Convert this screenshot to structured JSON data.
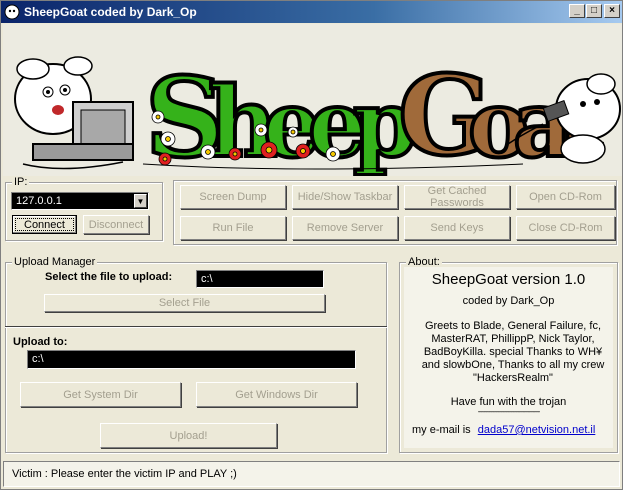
{
  "window": {
    "title": "SheepGoat coded by Dark_Op",
    "buttons": {
      "minimize": "_",
      "maximize": "□",
      "close": "×"
    }
  },
  "banner": {
    "logo_text": "SheepGoat"
  },
  "ip_group": {
    "label": "IP:",
    "ip_value": "127.0.0.1",
    "connect_label": "Connect",
    "disconnect_label": "Disconnect"
  },
  "actions": [
    {
      "label": "Screen Dump"
    },
    {
      "label": "Hide/Show Taskbar"
    },
    {
      "label": "Get Cached Passwords"
    },
    {
      "label": "Open CD-Rom"
    },
    {
      "label": "Run File"
    },
    {
      "label": "Remove Server"
    },
    {
      "label": "Send Keys"
    },
    {
      "label": "Close CD-Rom"
    }
  ],
  "upload": {
    "group_label": "Upload Manager",
    "select_label": "Select the file to upload:",
    "file_value": "c:\\",
    "select_button": "Select File",
    "upload_to_label": "Upload to:",
    "upload_to_value": "c:\\",
    "system_dir_button": "Get System Dir",
    "windows_dir_button": "Get Windows Dir",
    "upload_button": "Upload!"
  },
  "about": {
    "group_label": "About:",
    "version": "SheepGoat version 1.0",
    "coded_by": "coded by Dark_Op",
    "greets": "Greets to Blade, General Failure, fc, MasterRAT, PhillippP, Nick Taylor, BadBoyKilla. special Thanks to WH¥ and slowbOne, Thanks to all my crew \"HackersRealm\"",
    "fun": "Have fun with the trojan",
    "divider": "-------------------------------------",
    "email_label": "my e-mail is",
    "email": "dada57@netvision.net.il"
  },
  "status": {
    "text": "Victim :  Please enter the victim IP and PLAY  ;)"
  }
}
